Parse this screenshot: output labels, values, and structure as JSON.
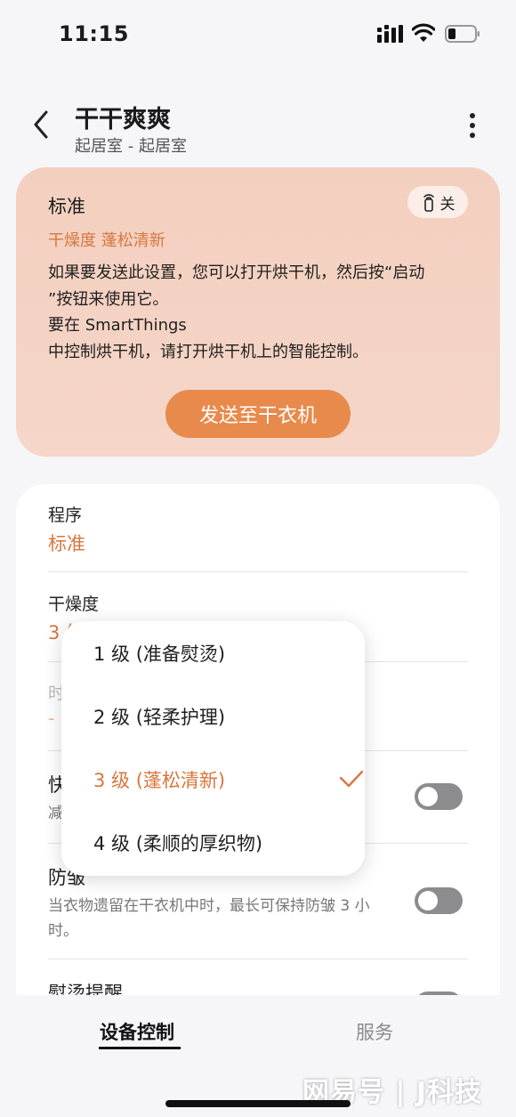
{
  "status_bar": {
    "time": "11:15"
  },
  "header": {
    "title": "干干爽爽",
    "subtitle": "起居室 - 起居室"
  },
  "info_card": {
    "program": "标准",
    "remote_toggle_label": "关",
    "dryness_summary": "干燥度 蓬松清新",
    "message_lines": [
      "如果要发送此设置，您可以打开烘干机，然后按“启动",
      "”按钮来使用它。",
      "要在 SmartThings",
      "中控制烘干机，请打开烘干机上的智能控制。"
    ],
    "send_button": "发送至干衣机"
  },
  "settings": {
    "program_label": "程序",
    "program_value": "标准",
    "dryness_label": "干燥度",
    "dryness_value": "3 级 (蓬松清新)",
    "time_label": "时",
    "time_value": "-",
    "quick_label": "快",
    "quick_desc": "减",
    "wrinkle_label": "防皱",
    "wrinkle_desc": "当衣物遗留在干衣机中时，最长可保持防皱 3 小时。",
    "iron_label": "熨烫提醒"
  },
  "dropdown": {
    "options": [
      "1 级 (准备熨烫)",
      "2 级 (轻柔护理)",
      "3 级 (蓬松清新)",
      "4 级 (柔顺的厚织物)"
    ],
    "selected_index": 2
  },
  "tabbar": {
    "active_tab": "设备控制",
    "inactive_tab": "服务"
  },
  "watermark": "网易号 | J科技",
  "colors": {
    "accent": "#d7773d",
    "button": "#e88a4c",
    "card_bg": "#f3cfbf"
  }
}
